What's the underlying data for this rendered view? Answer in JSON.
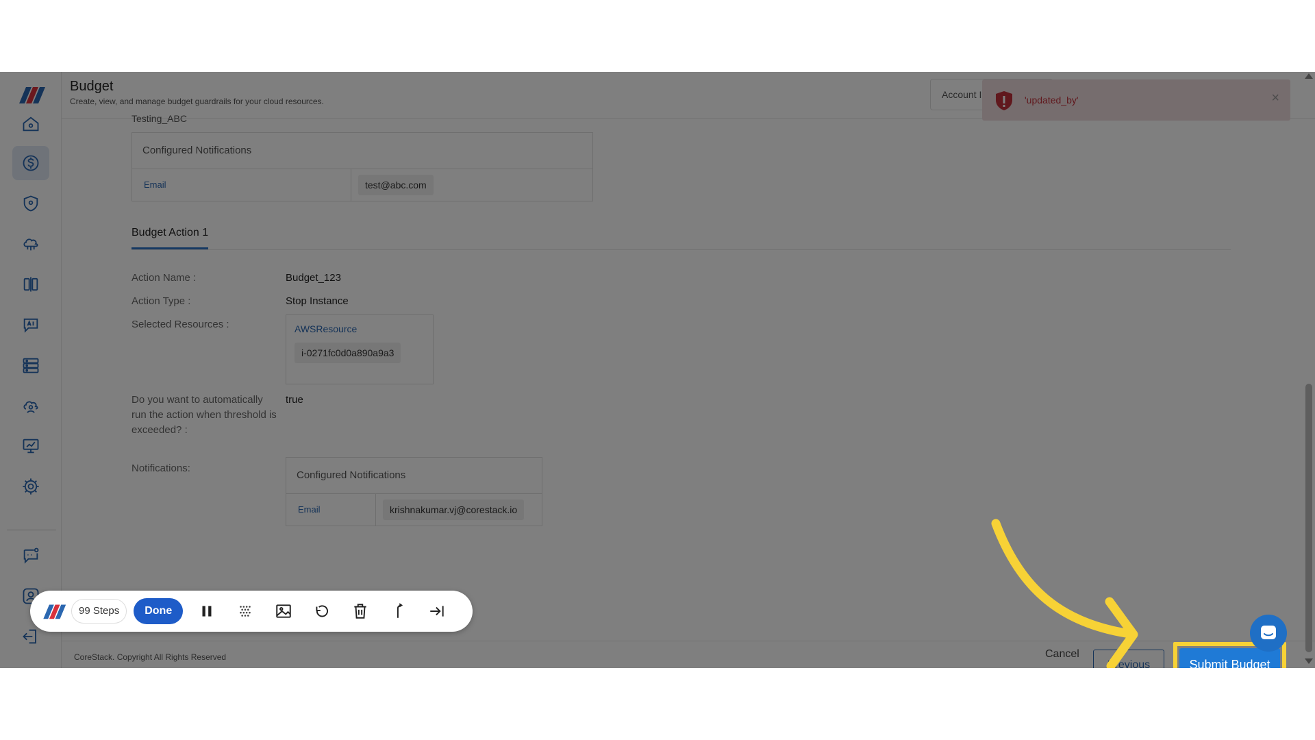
{
  "header": {
    "title": "Budget",
    "subtitle": "Create, view, and manage budget guardrails for your cloud resources.",
    "account_label": "Account I"
  },
  "toast": {
    "message": "'updated_by'",
    "close": "×"
  },
  "content": {
    "cut_text": "Testing_ABC",
    "top_notifications": {
      "heading": "Configured Notifications",
      "key": "Email",
      "value": "test@abc.com"
    },
    "tab_label": "Budget Action 1",
    "fields": {
      "action_name_label": "Action Name :",
      "action_name_value": "Budget_123",
      "action_type_label": "Action Type :",
      "action_type_value": "Stop Instance",
      "selected_resources_label": "Selected Resources :",
      "resource_type": "AWSResource",
      "resource_id": "i-0271fc0d0a890a9a3",
      "auto_run_label": "Do you want to automatically run the action when threshold is exceeded? :",
      "auto_run_value": "true",
      "notifications_label": "Notifications:"
    },
    "action_notifications": {
      "heading": "Configured Notifications",
      "key": "Email",
      "value": "krishnakumar.vj@corestack.io"
    }
  },
  "buttons": {
    "cancel": "Cancel",
    "previous": "Previous",
    "submit": "Submit Budget"
  },
  "footer": {
    "copyright": "CoreStack. Copyright All Rights Reserved"
  },
  "toolbar": {
    "steps": "99 Steps",
    "done": "Done"
  },
  "colors": {
    "accent": "#1f7ad6",
    "highlight": "#f7d236",
    "error": "#c0313a",
    "link": "#2b67b0"
  },
  "icons": {
    "nav": [
      "home-icon",
      "dollar-icon",
      "shield-icon",
      "cloud-network-icon",
      "compare-icon",
      "ai-chat-icon",
      "server-icon",
      "cloud-user-icon",
      "presentation-icon",
      "gear-icon",
      "chat-settings-icon",
      "user-settings-icon",
      "logout-icon"
    ],
    "toolbar": [
      "pause-icon",
      "blur-icon",
      "image-icon",
      "undo-icon",
      "trash-icon",
      "branch-icon",
      "skip-end-icon"
    ]
  }
}
